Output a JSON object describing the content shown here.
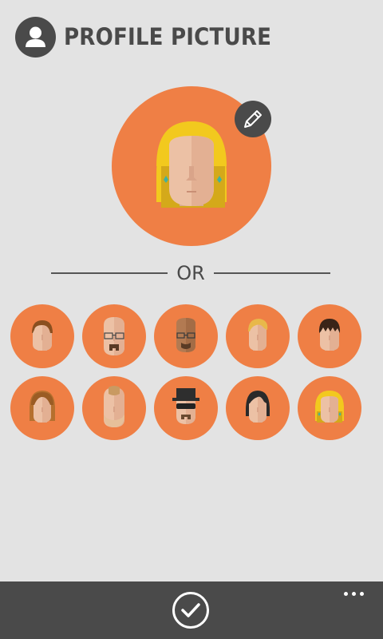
{
  "header": {
    "title": "PROFILE PICTURE",
    "icon": "person-icon"
  },
  "selected_avatar": {
    "description_icon": "avatar-blonde-woman-icon",
    "edit_icon": "pencil-icon"
  },
  "divider": {
    "label": "OR"
  },
  "avatar_options": [
    {
      "icon": "avatar-brown-hair-man-icon"
    },
    {
      "icon": "avatar-bald-glasses-goatee-icon"
    },
    {
      "icon": "avatar-dark-skin-glasses-icon"
    },
    {
      "icon": "avatar-blonde-short-hair-icon"
    },
    {
      "icon": "avatar-dark-spiky-hair-icon"
    },
    {
      "icon": "avatar-brown-long-hair-woman-icon"
    },
    {
      "icon": "avatar-bald-bearded-man-icon"
    },
    {
      "icon": "avatar-hat-sunglasses-icon"
    },
    {
      "icon": "avatar-black-hair-woman-icon"
    },
    {
      "icon": "avatar-blonde-woman-icon"
    }
  ],
  "app_bar": {
    "confirm_icon": "checkmark-icon",
    "more_icon": "more-options-icon"
  },
  "colors": {
    "background": "#e3e3e3",
    "accent_orange": "#ef7f45",
    "dark_gray": "#4a4a4a"
  }
}
